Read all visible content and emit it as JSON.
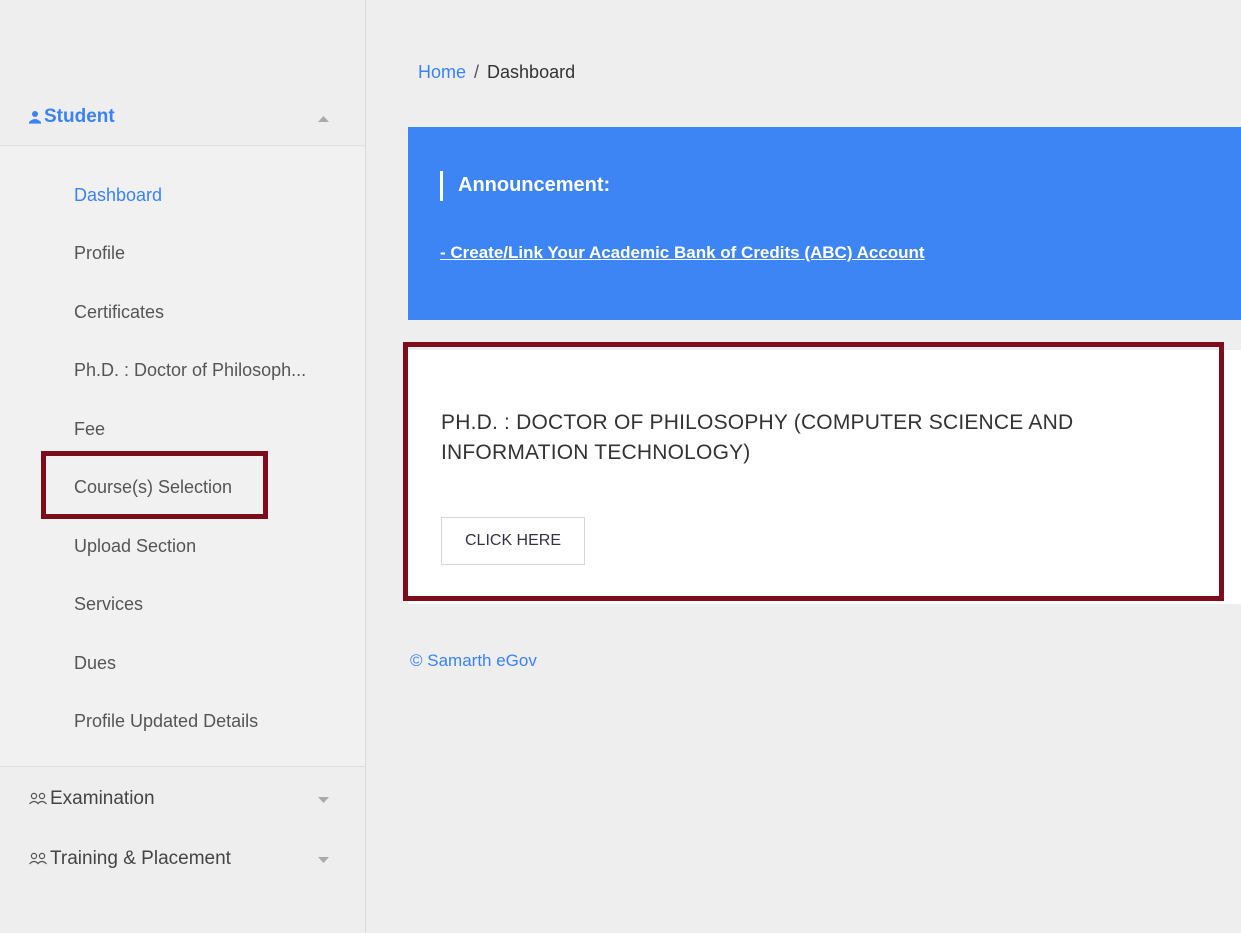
{
  "sidebar": {
    "student_label": "Student",
    "student_items": [
      {
        "label": "Dashboard"
      },
      {
        "label": "Profile"
      },
      {
        "label": "Certificates"
      },
      {
        "label": "Ph.D. : Doctor of Philosoph..."
      },
      {
        "label": "Fee"
      },
      {
        "label": "Course(s) Selection"
      },
      {
        "label": "Upload Section"
      },
      {
        "label": "Services"
      },
      {
        "label": "Dues"
      },
      {
        "label": "Profile Updated Details"
      }
    ],
    "examination_label": "Examination",
    "training_label": "Training & Placement"
  },
  "breadcrumb": {
    "home": "Home",
    "separator": "/",
    "current": "Dashboard"
  },
  "announcement": {
    "title": "Announcement:",
    "link": "- Create/Link Your Academic Bank of Credits (ABC) Account"
  },
  "program_card": {
    "heading": "PH.D. : DOCTOR OF PHILOSOPHY (COMPUTER SCIENCE AND INFORMATION TECHNOLOGY)",
    "button": "CLICK HERE"
  },
  "footer": {
    "text": "© Samarth eGov"
  },
  "colors": {
    "accent": "#3b82f6",
    "banner": "#3d84f4",
    "highlight": "#7d0d1c"
  }
}
